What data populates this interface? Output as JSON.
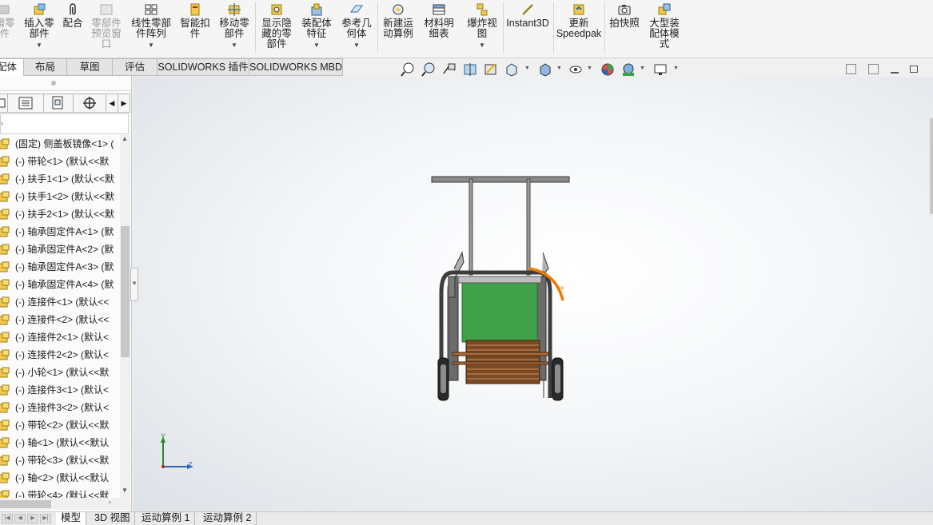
{
  "ribbon": {
    "items": [
      {
        "label": "插入零\n部件",
        "disabled": false
      },
      {
        "label": "配合",
        "disabled": false
      },
      {
        "label": "零部件\n预览窗\n口",
        "disabled": true
      },
      {
        "label": "线性零部\n件阵列",
        "disabled": false
      },
      {
        "label": "智能扣\n件",
        "disabled": false
      },
      {
        "label": "移动零\n部件",
        "disabled": false
      },
      {
        "label": "显示隐\n藏的零\n部件",
        "disabled": false
      },
      {
        "label": "装配体\n特征",
        "disabled": false
      },
      {
        "label": "参考几\n何体",
        "disabled": false
      },
      {
        "label": "新建运\n动算例",
        "disabled": false
      },
      {
        "label": "材料明\n细表",
        "disabled": false
      },
      {
        "label": "爆炸视\n图",
        "disabled": false
      },
      {
        "label": "Instant3D",
        "disabled": false
      },
      {
        "label": "更新\nSpeedpak",
        "disabled": false
      },
      {
        "label": "拍快照",
        "disabled": false
      },
      {
        "label": "大型装\n配体模\n式",
        "disabled": false
      }
    ],
    "cut_first_label": "辑零\n件"
  },
  "command_tabs": [
    {
      "label": "装配体",
      "active": true
    },
    {
      "label": "布局",
      "active": false
    },
    {
      "label": "草图",
      "active": false
    },
    {
      "label": "评估",
      "active": false
    },
    {
      "label": "SOLIDWORKS 插件",
      "active": false
    },
    {
      "label": "SOLIDWORKS MBD",
      "active": false
    }
  ],
  "feature_tree": {
    "items": [
      "(固定) 侧盖板镜像<1> (",
      "(-) 带轮<1> (默认<<默",
      "(-) 扶手1<1> (默认<<默",
      "(-) 扶手1<2> (默认<<默",
      "(-) 扶手2<1> (默认<<默",
      "(-) 轴承固定件A<1> (默",
      "(-) 轴承固定件A<2> (默",
      "(-) 轴承固定件A<3> (默",
      "(-) 轴承固定件A<4> (默",
      "(-) 连接件<1> (默认<<",
      "(-) 连接件<2> (默认<<",
      "(-) 连接件2<1> (默认<",
      "(-) 连接件2<2> (默认<",
      "(-) 小轮<1> (默认<<默",
      "(-) 连接件3<1> (默认<",
      "(-) 连接件3<2> (默认<",
      "(-) 带轮<2> (默认<<默",
      "(-) 轴<1> (默认<<默认",
      "(-) 带轮<3> (默认<<默",
      "(-) 轴<2> (默认<<默认",
      "(-) 带轮<4> (默认<<默"
    ]
  },
  "viewport": {
    "triad": {
      "y_label": "Y",
      "z_label": "Z"
    }
  },
  "bottom_tabs": [
    {
      "label": "模型",
      "active": true
    },
    {
      "label": "3D 视图",
      "active": false
    },
    {
      "label": "运动算例 1",
      "active": false
    },
    {
      "label": "运动算例 2",
      "active": false
    }
  ],
  "colors": {
    "accent_yellow": "#e8b400",
    "frame_gray": "#5a5a5a",
    "panel_green": "#3fa24a",
    "roller_brown": "#7a4a24",
    "highlight_orange": "#f07a00"
  }
}
